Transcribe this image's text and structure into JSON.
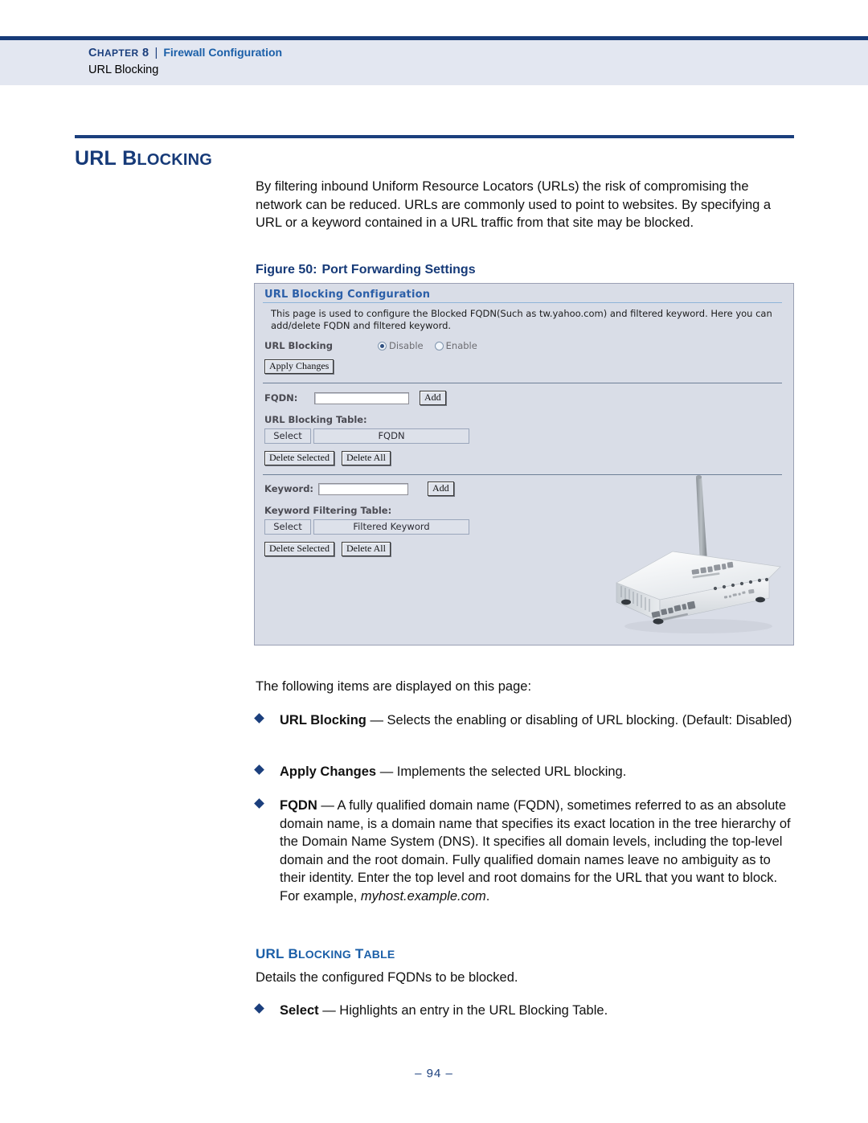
{
  "header": {
    "chapter_label": "CHAPTER 8",
    "separator": "|",
    "chapter_title": "Firewall Configuration",
    "section": "URL Blocking"
  },
  "page_title": "URL BLOCKING",
  "intro_paragraph": "By filtering inbound Uniform Resource Locators (URLs) the risk of compromising the network can be reduced. URLs are commonly used to point to websites. By specifying a URL or a keyword contained in a URL traffic from that site may be blocked.",
  "figure": {
    "caption_number": "Figure 50:",
    "caption_text": "Port Forwarding Settings",
    "ui": {
      "panel_title": "URL Blocking Configuration",
      "description": "This page is used to configure the Blocked FQDN(Such as tw.yahoo.com) and filtered keyword. Here you can add/delete FQDN and filtered keyword.",
      "url_blocking_label": "URL Blocking",
      "radio_disable": "Disable",
      "radio_enable": "Enable",
      "radio_selected": "Disable",
      "apply_changes_button": "Apply Changes",
      "fqdn_label": "FQDN:",
      "fqdn_value": "",
      "fqdn_add_button": "Add",
      "url_blocking_table_label": "URL Blocking Table:",
      "url_table_col_select": "Select",
      "url_table_col_fqdn": "FQDN",
      "url_delete_selected_button": "Delete Selected",
      "url_delete_all_button": "Delete All",
      "keyword_label": "Keyword:",
      "keyword_value": "",
      "keyword_add_button": "Add",
      "keyword_table_label": "Keyword Filtering Table:",
      "keyword_table_col_select": "Select",
      "keyword_table_col_filtered": "Filtered Keyword",
      "keyword_delete_selected_button": "Delete Selected",
      "keyword_delete_all_button": "Delete All",
      "device_photo": "wireless-router-photo"
    }
  },
  "after_figure_paragraph": "The following items are displayed on this page:",
  "bullets": [
    {
      "term": "URL Blocking",
      "dash": " — ",
      "text": "Selects the enabling or disabling of URL blocking. (Default: Disabled)"
    },
    {
      "term": "Apply Changes",
      "dash": " — ",
      "text": "Implements the selected URL blocking."
    },
    {
      "term": "FQDN",
      "dash": " — ",
      "text": "A fully qualified domain name (FQDN), sometimes referred to as an absolute domain name, is a domain name that specifies its exact location in the tree hierarchy of the Domain Name System (DNS). It specifies all domain levels, including the top-level domain and the root domain. Fully qualified domain names leave no ambiguity as to their identity. Enter the top level and root domains for the URL that you want to block. For example, ",
      "italic_tail": "myhost.example.com",
      "tail": "."
    }
  ],
  "subsection": {
    "heading": "URL BLOCKING TABLE",
    "description": "Details the configured FQDNs to be blocked.",
    "bullet": {
      "term": "Select",
      "dash": " — ",
      "text": "Highlights an entry in the URL Blocking Table."
    }
  },
  "page_number": "–  94  –",
  "colors": {
    "navy": "#163a78",
    "link_blue": "#1b5fa8",
    "header_band": "#e3e7f1",
    "ui_background": "#d9dde7",
    "ui_title_blue": "#2b5fa8"
  }
}
